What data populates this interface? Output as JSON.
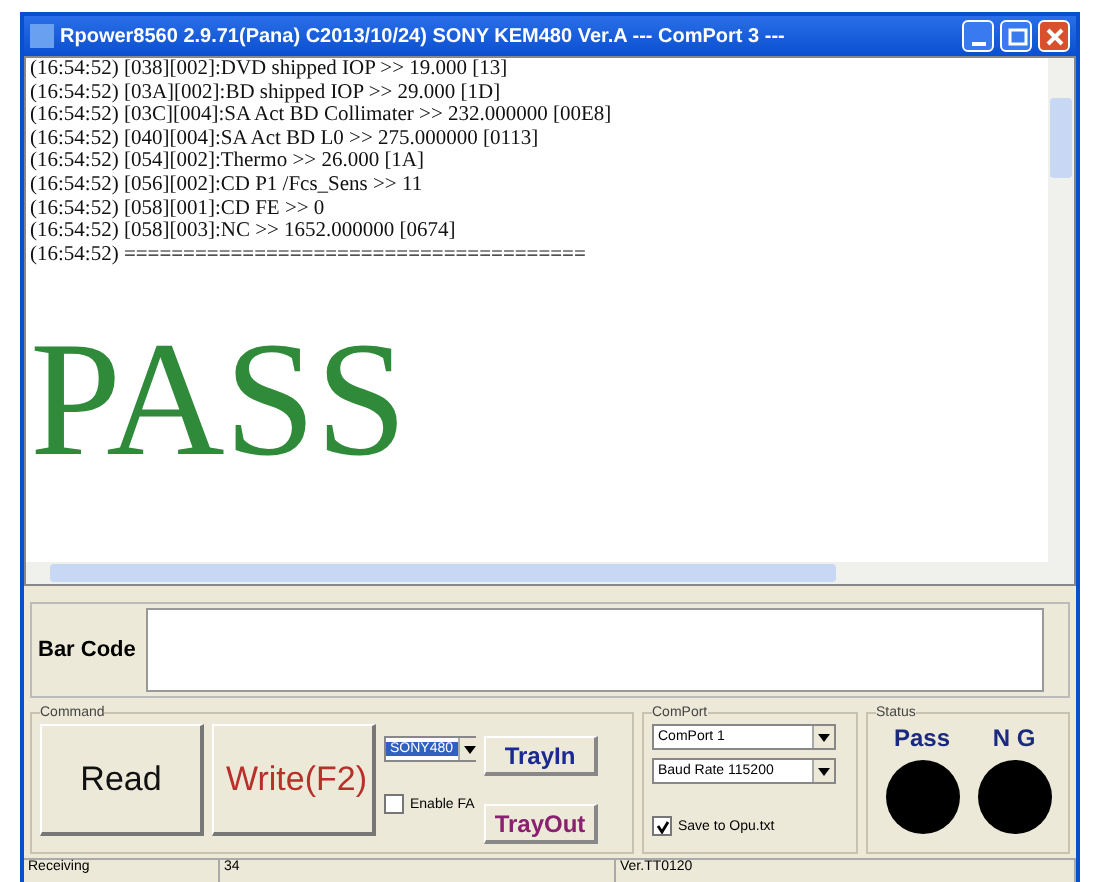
{
  "window": {
    "title": "Rpower8560 2.9.71(Pana) C2013/10/24)   SONY KEM480 Ver.A --- ComPort 3 ---"
  },
  "log": {
    "lines": [
      "(16:54:52) [038][002]:DVD shipped IOP >> 19.000 [13]",
      "(16:54:52) [03A][002]:BD shipped IOP >> 29.000 [1D]",
      "(16:54:52) [03C][004]:SA Act BD Collimater >> 232.000000 [00E8]",
      "(16:54:52) [040][004]:SA Act BD L0 >> 275.000000 [0113]",
      "(16:54:52) [054][002]:Thermo >> 26.000 [1A]",
      "(16:54:52) [056][002]:CD P1 /Fcs_Sens >> 11",
      "(16:54:52) [058][001]:CD FE >> 0",
      "(16:54:52) [058][003]:NC >> 1652.000000 [0674]",
      "(16:54:52) ======================================="
    ],
    "result": "PASS"
  },
  "barcode": {
    "label": "Bar Code"
  },
  "command": {
    "title": "Command",
    "read": "Read",
    "write": "Write(F2)",
    "model": "SONY480",
    "enable_fa": {
      "label": "Enable FA",
      "checked": false
    },
    "tray_in": "TrayIn",
    "tray_out": "TrayOut"
  },
  "comport": {
    "title": "ComPort",
    "port": "ComPort 1",
    "baud": "Baud Rate 115200",
    "save": {
      "label": "Save to Opu.txt",
      "checked": true
    }
  },
  "status": {
    "title": "Status",
    "lamps": [
      {
        "label": "Pass",
        "color": "#000000"
      },
      {
        "label": "N G",
        "color": "#000000"
      }
    ]
  },
  "status_bar": [
    "Receiving",
    "34",
    "Ver.TT0120"
  ]
}
